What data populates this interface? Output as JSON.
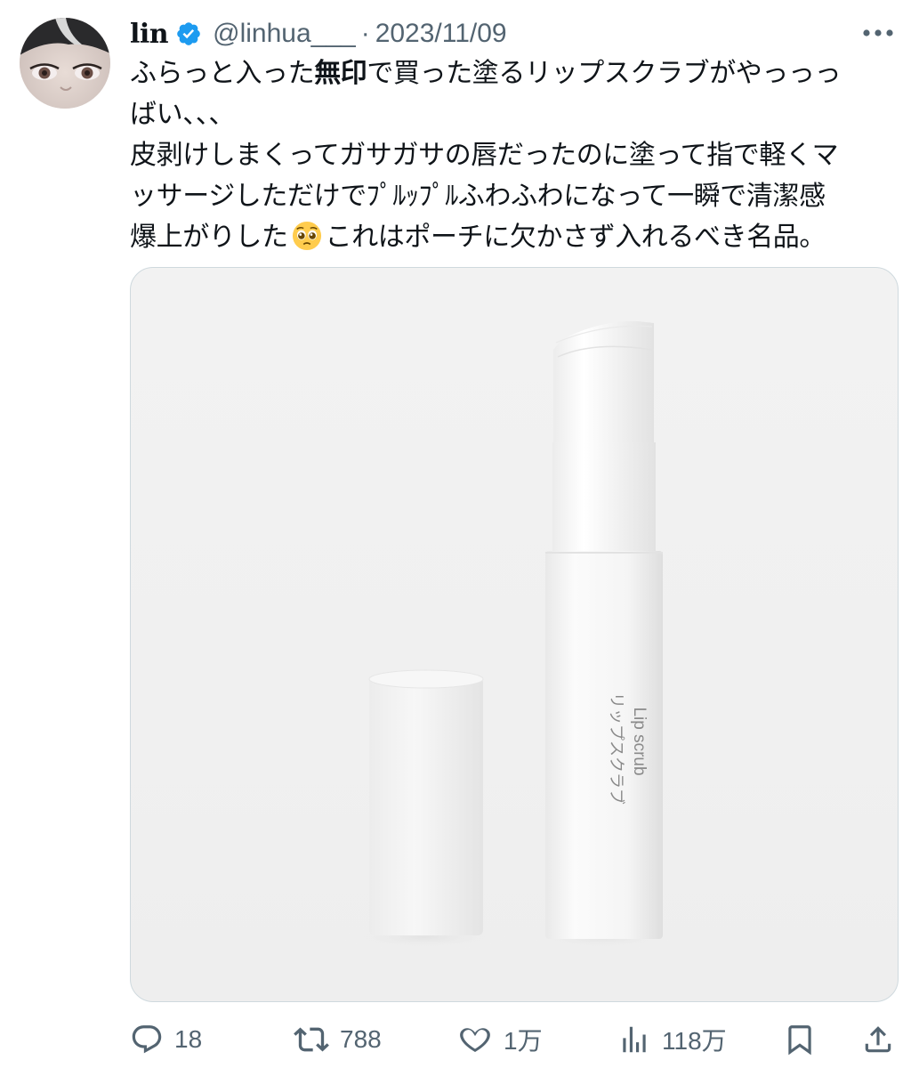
{
  "post": {
    "author": {
      "name": "lin",
      "handle": "@linhua___",
      "verified": true,
      "avatar_icon": "profile-photo"
    },
    "separator": "·",
    "date": "2023/11/09",
    "text": {
      "line1_a": "ふらっと入った",
      "line1_bold": "無印",
      "line1_b": "で買った塗るリップスクラブがやっっっ",
      "line2": "ばい、、、",
      "line3": "皮剥けしまくってガサガサの唇だったのに塗って指で軽くマ",
      "line4": "ッサージしただけでﾌﾟﾙｯﾌﾟﾙふわふわになって一瞬で清潔感",
      "line5_a": "爆上がりした",
      "line5_emoji": "pleading-face",
      "line5_b": "これはポーチに欠かさず入れるべき名品。"
    },
    "media": {
      "product_label_jp": "リップスクラブ",
      "product_label_en": "Lip scrub"
    },
    "metrics": {
      "replies": "18",
      "reposts": "788",
      "likes": "1万",
      "views": "118万"
    }
  },
  "colors": {
    "text": "#0f1419",
    "secondary": "#536471",
    "verified": "#1d9bf0",
    "border": "#cfd9de"
  },
  "icons": {
    "more": "more-icon",
    "reply": "reply-icon",
    "repost": "repost-icon",
    "like": "heart-icon",
    "views": "views-icon",
    "bookmark": "bookmark-icon",
    "share": "share-icon"
  }
}
